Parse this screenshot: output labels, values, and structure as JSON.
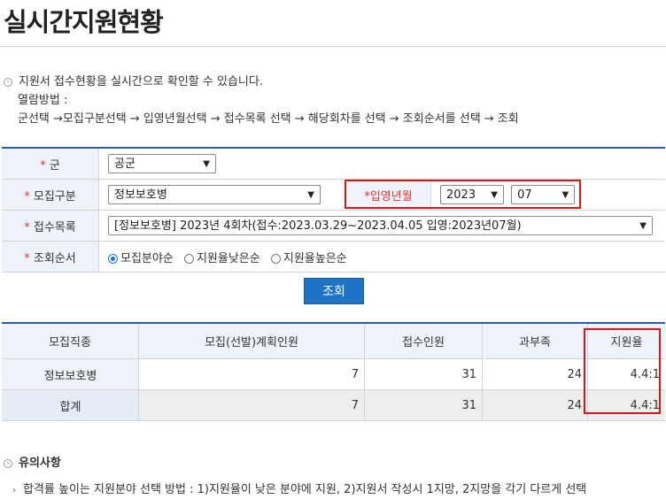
{
  "page": {
    "title": "실시간지원현황"
  },
  "info": {
    "bullet_icon": "circle-arrow-right-icon",
    "line1": "지원서 접수현황을 실시간으로 확인할 수 있습니다.",
    "line2": "열람방법 :",
    "line3": "군선택 →모집구분선택 → 입영년월선택 → 접수목록 선택 → 해당회차를 선택 → 조회순서를 선택 → 조회"
  },
  "form": {
    "required_mark": "*",
    "branch_label": "군",
    "branch_value": "공군",
    "recruit_label": "모집구분",
    "recruit_value": "정보보호병",
    "enlist_label": "*입영년월",
    "year_value": "2023",
    "month_value": "07",
    "list_label": "접수목록",
    "list_value": "[정보보호병] 2023년 4회차(접수:2023.03.29~2023.04.05 입영:2023년07월)",
    "order_label": "조회순서",
    "order_options": [
      "모집분야순",
      "지원율낮은순",
      "지원율높은순"
    ],
    "order_selected": 0,
    "search_button": "조회",
    "highlight_color": "#d9141a"
  },
  "results": {
    "headers": [
      "모집직종",
      "모집(선발)계획인원",
      "접수인원",
      "과부족",
      "지원율"
    ],
    "rows": [
      [
        "정보보호병",
        "7",
        "31",
        "24",
        "4.4:1"
      ]
    ],
    "total": [
      "합계",
      "7",
      "31",
      "24",
      "4.4:1"
    ]
  },
  "notice": {
    "title": "유의사항",
    "item": "합격률 높이는 지원분야 선택 방법 : 1)지원율이 낮은 분야에 지원, 2)지원서 작성시 1지망, 2지망을 각기 다르게 선택"
  }
}
